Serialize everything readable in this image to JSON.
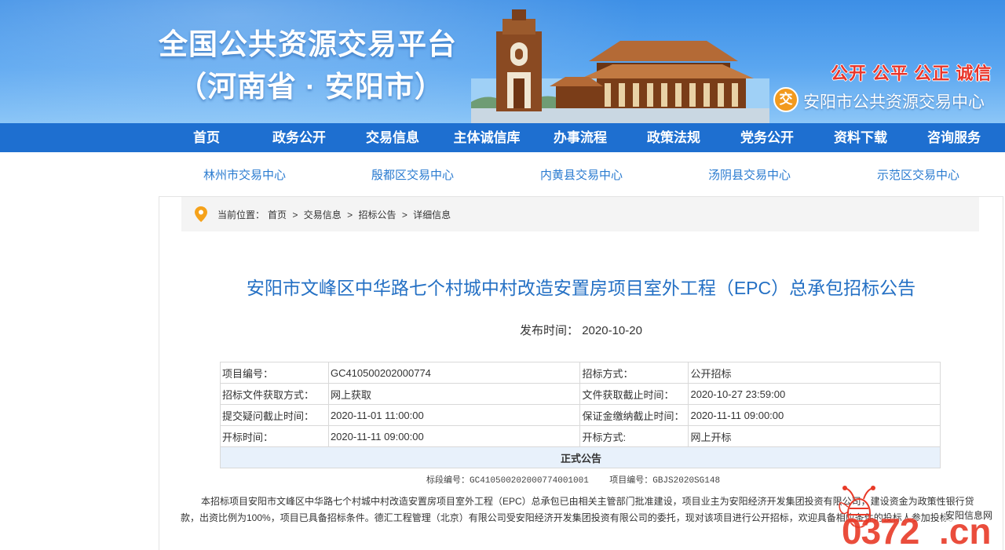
{
  "banner": {
    "title_line1": "全国公共资源交易平台",
    "title_line2": "（河南省 · 安阳市）",
    "slogan": "公开 公平 公正 诚信",
    "center_logo_glyph": "交",
    "center_name": "安阳市公共资源交易中心"
  },
  "nav": {
    "items": [
      "首页",
      "政务公开",
      "交易信息",
      "主体诚信库",
      "办事流程",
      "政策法规",
      "党务公开",
      "资料下载",
      "咨询服务"
    ]
  },
  "subnav": {
    "items": [
      "林州市交易中心",
      "殷都区交易中心",
      "内黄县交易中心",
      "汤阴县交易中心",
      "示范区交易中心"
    ]
  },
  "breadcrumb": {
    "prefix": "当前位置：",
    "items": [
      "首页",
      "交易信息",
      "招标公告",
      "详细信息"
    ],
    "separator": ">"
  },
  "article": {
    "title": "安阳市文峰区中华路七个村城中村改造安置房项目室外工程（EPC）总承包招标公告",
    "publish_label": "发布时间：",
    "publish_date": "2020-10-20"
  },
  "info_table": {
    "rows": [
      [
        "项目编号：",
        "GC410500202000774",
        "招标方式：",
        "公开招标"
      ],
      [
        "招标文件获取方式：",
        "网上获取",
        "文件获取截止时间：",
        "2020-10-27 23:59:00"
      ],
      [
        "提交疑问截止时间：",
        "2020-11-01 11:00:00",
        "保证金缴纳截止时间：",
        "2020-11-11 09:00:00"
      ],
      [
        "开标时间：",
        "2020-11-11 09:00:00",
        "开标方式:",
        "网上开标"
      ]
    ],
    "notice_header": "正式公告"
  },
  "meta": {
    "section_label": "标段编号：",
    "section_no": "GC410500202000774001001",
    "project_label": "项目编号：",
    "project_no": "GBJS2020SG148"
  },
  "body_text": "本招标项目安阳市文峰区中华路七个村城中村改造安置房项目室外工程（EPC）总承包已由相关主管部门批准建设，项目业主为安阳经济开发集团投资有限公司，建设资金为政策性银行贷款，出资比例为100%，项目已具备招标条件。德汇工程管理（北京）有限公司受安阳经济开发集团投资有限公司的委托，现对该项目进行公开招标，欢迎具备相应条件的投标人参加投标。",
  "watermark": {
    "number": "0372",
    "tld": ".cn",
    "site_name": "安阳信息网"
  },
  "colors": {
    "banner_blue": "#3d8fe6",
    "nav_blue": "#1e6fd0",
    "link_blue": "#2a7bd0",
    "title_blue": "#2470c4",
    "slogan_red": "#e8352a",
    "notice_bg": "#e8f1fb"
  }
}
